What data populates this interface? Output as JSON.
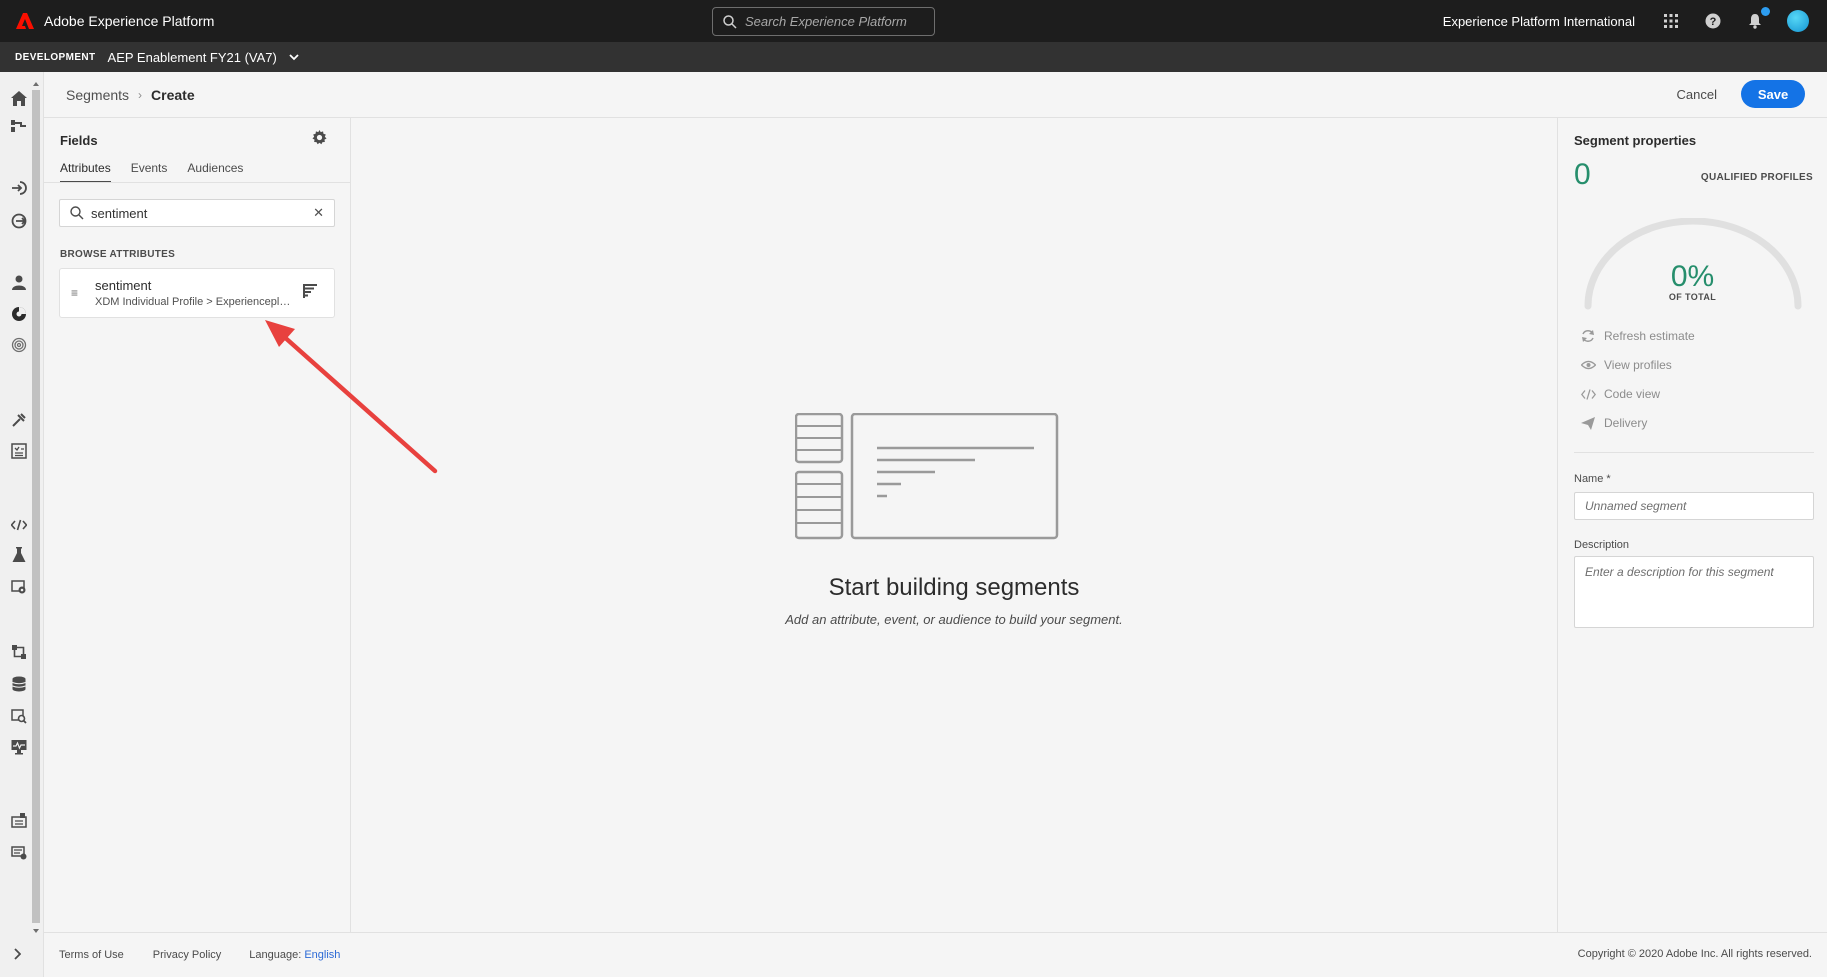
{
  "app": {
    "brand": "Adobe Experience Platform",
    "search_placeholder": "Search Experience Platform",
    "org_name": "Experience Platform International"
  },
  "sandbox": {
    "tag": "DEVELOPMENT",
    "name": "AEP Enablement FY21 (VA7)"
  },
  "breadcrumb": {
    "parent": "Segments",
    "current": "Create"
  },
  "actions": {
    "cancel": "Cancel",
    "save": "Save"
  },
  "fields": {
    "title": "Fields",
    "tabs": [
      "Attributes",
      "Events",
      "Audiences"
    ],
    "active_tab": "Attributes",
    "search_value": "sentiment",
    "browse_label": "BROWSE ATTRIBUTES",
    "results": [
      {
        "name": "sentiment",
        "path": "XDM Individual Profile > Experienceplatfor..."
      }
    ]
  },
  "canvas": {
    "title": "Start building segments",
    "subtitle": "Add an attribute, event, or audience to build your segment."
  },
  "properties": {
    "title": "Segment properties",
    "qualified_count": "0",
    "qualified_label": "QUALIFIED PROFILES",
    "gauge_value": "0%",
    "gauge_label": "OF TOTAL",
    "gauge_fraction": 0,
    "actions": [
      "Refresh estimate",
      "View profiles",
      "Code view",
      "Delivery"
    ],
    "name_label": "Name *",
    "name_placeholder": "Unnamed segment",
    "description_label": "Description",
    "description_placeholder": "Enter a description for this segment"
  },
  "footer": {
    "terms": "Terms of Use",
    "privacy": "Privacy Policy",
    "language_label": "Language:",
    "language_value": "English",
    "copyright": "Copyright  ©  2020 Adobe Inc.  All rights reserved."
  },
  "colors": {
    "accent": "#1473e6",
    "success": "#268e6c",
    "topbar": "#1d1d1d",
    "annotation_arrow": "#e8413e"
  }
}
